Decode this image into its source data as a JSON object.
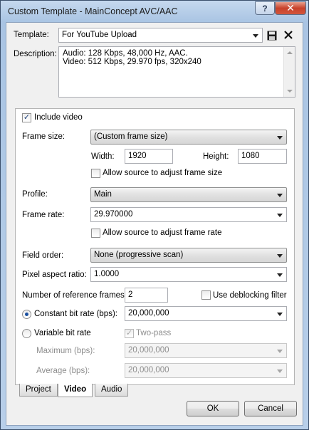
{
  "window": {
    "title": "Custom Template - MainConcept AVC/AAC",
    "help": "?",
    "close": "✕"
  },
  "template": {
    "label": "Template:",
    "value": "For YouTube Upload"
  },
  "description": {
    "label": "Description:",
    "line1": "Audio: 128 Kbps, 48,000 Hz, AAC.",
    "line2": "Video: 512 Kbps, 29.970 fps, 320x240"
  },
  "video": {
    "include_video": "Include video",
    "frame_size_label": "Frame size:",
    "frame_size_value": "(Custom frame size)",
    "width_label": "Width:",
    "width_value": "1920",
    "height_label": "Height:",
    "height_value": "1080",
    "allow_frame_size": "Allow source to adjust frame size",
    "profile_label": "Profile:",
    "profile_value": "Main",
    "frame_rate_label": "Frame rate:",
    "frame_rate_value": "29.970000",
    "allow_frame_rate": "Allow source to adjust frame rate",
    "field_order_label": "Field order:",
    "field_order_value": "None (progressive scan)",
    "par_label": "Pixel aspect ratio:",
    "par_value": "1.0000",
    "ref_frames_label": "Number of reference frames:",
    "ref_frames_value": "2",
    "deblocking": "Use deblocking filter",
    "cbr_label": "Constant bit rate (bps):",
    "cbr_value": "20,000,000",
    "vbr_label": "Variable bit rate",
    "two_pass": "Two-pass",
    "max_label": "Maximum (bps):",
    "max_value": "20,000,000",
    "avg_label": "Average (bps):",
    "avg_value": "20,000,000"
  },
  "tabs": [
    "Project",
    "Video",
    "Audio"
  ],
  "buttons": {
    "ok": "OK",
    "cancel": "Cancel"
  }
}
